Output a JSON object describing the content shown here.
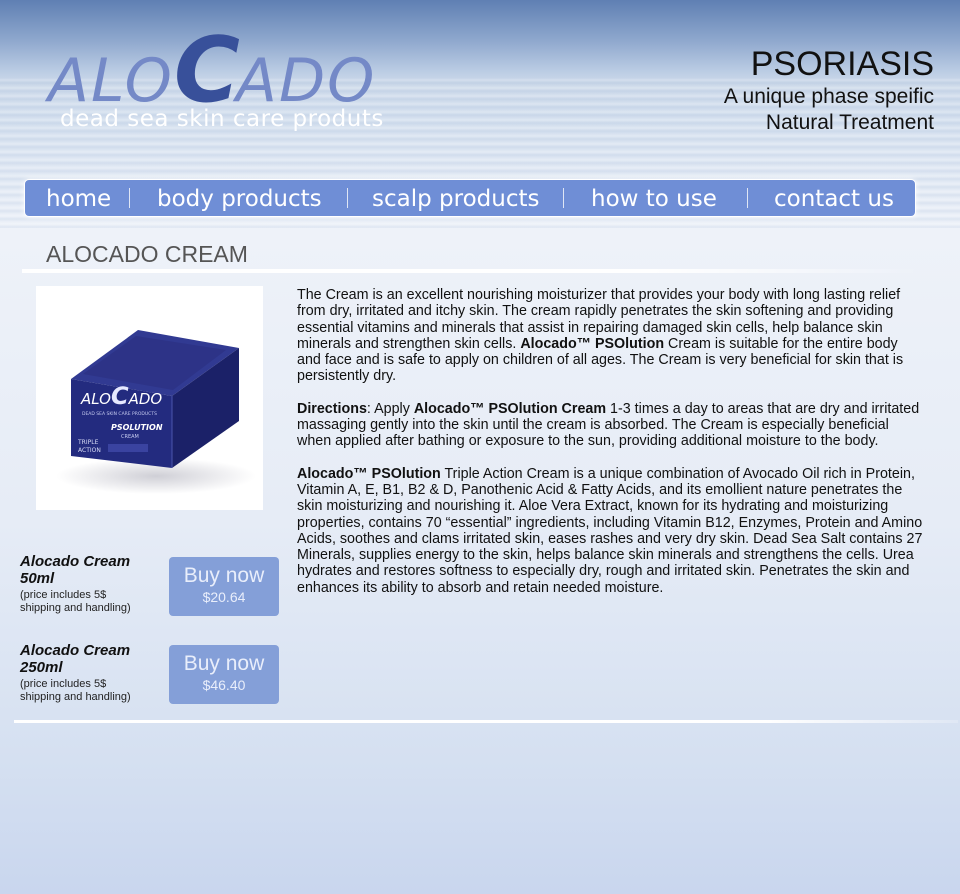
{
  "header": {
    "logo_pre": "ALO",
    "logo_big": "C",
    "logo_post": "ADO",
    "tagline": "dead sea skin care produts",
    "headline_title": "PSORIASIS",
    "headline_line1": "A unique phase speific",
    "headline_line2": "Natural Treatment"
  },
  "nav": {
    "items": [
      {
        "label": "home"
      },
      {
        "label": "body products"
      },
      {
        "label": "scalp products"
      },
      {
        "label": "how to use"
      },
      {
        "label": "contact us"
      }
    ]
  },
  "page_title": "ALOCADO CREAM",
  "product_image": {
    "box_logo_pre": "ALO",
    "box_logo_big": "C",
    "box_logo_post": "ADO",
    "box_line1": "DEAD SEA SKIN CARE PRODUCTS",
    "box_product": "PSOLUTION",
    "box_sub": "CREAM",
    "box_side1": "TRIPLE",
    "box_side2": "ACTION"
  },
  "offers": [
    {
      "name_line1": "Alocado Cream",
      "name_line2": "50ml",
      "note_line1": "(price includes 5$",
      "note_line2": "shipping and handling)",
      "buy_label": "Buy now",
      "price": "$20.64"
    },
    {
      "name_line1": "Alocado Cream",
      "name_line2": "250ml",
      "note_line1": "(price includes 5$",
      "note_line2": "shipping and handling)",
      "buy_label": "Buy now",
      "price": "$46.40"
    }
  ],
  "content": {
    "p1_text": " The Cream is an excellent nourishing moisturizer that provides your body with long lasting relief from dry, irritated and itchy skin.  The cream rapidly penetrates the skin softening and providing essential vitamins and minerals that assist in repairing damaged skin cells, help balance skin minerals and strengthen skin cells.  ",
    "p1_bold": "Alocado™ PSOlution",
    "p1_tail": " Cream is suitable for the entire body and face and is safe to apply on children of all ages. The Cream is very beneficial for skin that is persistently dry.",
    "p2_label": "Directions",
    "p2_a": ":  Apply ",
    "p2_bold": "Alocado™ PSOlution Cream",
    "p2_b": " 1-3 times a day to areas that are dry and irritated massaging gently into the skin until the cream is absorbed. The Cream is especially beneficial when applied after bathing or exposure to the sun, providing additional moisture to the body.",
    "p3_bold": "Alocado™ PSOlution",
    "p3_text": " Triple Action Cream is a unique combination of Avocado Oil rich in Protein, Vitamin A, E, B1, B2 & D, Panothenic Acid & Fatty Acids, and its emollient nature penetrates the skin moisturizing and nourishing it.  Aloe Vera Extract, known for its hydrating and moisturizing properties, contains 70 “essential” ingredients, including Vitamin B12, Enzymes, Protein and Amino Acids, soothes and clams irritated skin, eases rashes and very dry skin.  Dead Sea Salt contains 27 Minerals, supplies energy to the skin, helps balance skin minerals and strengthens the cells.  Urea hydrates and restores softness to especially dry, rough and irritated skin.  Penetrates the skin and enhances its ability to absorb and retain needed moisture."
  }
}
